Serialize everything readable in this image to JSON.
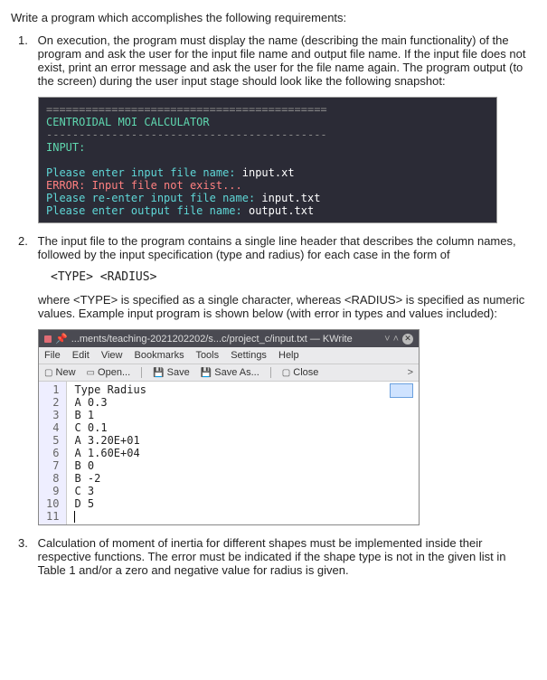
{
  "intro": "Write a program which accomplishes the following requirements:",
  "items": [
    {
      "num": "1.",
      "text": "On execution, the program must display the name (describing the main functionality) of the program and ask the user for the input file name and output file name. If the input file does not exist, print an error message and ask the user for the file name again. The program output (to the screen) during the user input stage should look like the following snapshot:"
    },
    {
      "num": "2.",
      "text": "The input file to the program contains a single line header that describes the column names, followed by the input specification (type and radius) for each case in the form of"
    },
    {
      "num": "3.",
      "text": "Calculation of moment of inertia for different shapes must be implemented inside their respective functions. The error must be indicated if the shape type is not in the given list in Table 1 and/or a zero and negative value for radius is given."
    }
  ],
  "terminal": {
    "sep1": "===========================================",
    "title": "CENTROIDAL MOI CALCULATOR",
    "sep2": "-------------------------------------------",
    "input_label": "INPUT:",
    "l1a": "Please enter input file name: ",
    "l1b": "input.xt",
    "l2": "ERROR: Input file not exist...",
    "l3a": "Please re-enter input file name: ",
    "l3b": "input.txt",
    "l4a": "Please enter output file name: ",
    "l4b": "output.txt"
  },
  "syntax": "<TYPE> <RADIUS>",
  "item2_after": "where <TYPE> is specified as a single character, whereas <RADIUS> is specified as numeric values. Example input program is shown below (with error in types and values included):",
  "editor": {
    "titlebar": "...ments/teaching-2021202202/s...c/project_c/input.txt — KWrite",
    "titlechev": "˅ ˄",
    "menu": {
      "file": "File",
      "edit": "Edit",
      "view": "View",
      "bookmarks": "Bookmarks",
      "tools": "Tools",
      "settings": "Settings",
      "help": "Help"
    },
    "tool": {
      "new": "New",
      "open": "Open...",
      "save": "Save",
      "saveas": "Save As...",
      "close": "Close",
      "chev": ">"
    },
    "gutter": [
      "1",
      "2",
      "3",
      "4",
      "5",
      "6",
      "7",
      "8",
      "9",
      "10",
      "11"
    ],
    "lines": [
      "Type Radius",
      "A 0.3",
      "B 1",
      "C 0.1",
      "A 3.20E+01",
      "A 1.60E+04",
      "B 0",
      "B -2",
      "C 3",
      "D 5",
      ""
    ]
  }
}
